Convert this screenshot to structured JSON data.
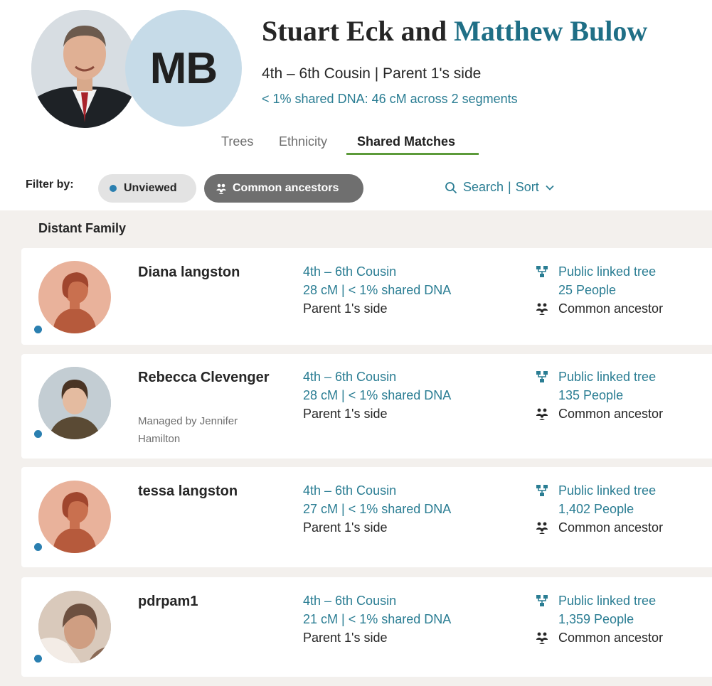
{
  "header": {
    "initials": "MB",
    "title_name_a": "Stuart Eck and ",
    "title_name_b": "Matthew Bulow",
    "relationship": "4th – 6th Cousin | Parent 1's side",
    "shared_dna": "< 1% shared DNA: 46 cM across 2 segments"
  },
  "tabs": [
    {
      "label": "Trees"
    },
    {
      "label": "Ethnicity"
    },
    {
      "label": "Shared Matches",
      "active": true
    }
  ],
  "filter": {
    "label": "Filter by:",
    "unviewed": "Unviewed",
    "common_ancestors": "Common ancestors",
    "search": "Search",
    "separator": "|",
    "sort": "Sort"
  },
  "section": {
    "title": "Distant Family"
  },
  "matches": [
    {
      "name": "Diana langston",
      "managed_by": "",
      "relationship": "4th – 6th Cousin",
      "dna": "28 cM | < 1% shared DNA",
      "side": "Parent 1's side",
      "tree": "Public linked tree",
      "people": "25 People",
      "ancestor": "Common ancestor",
      "avatar": "silhouette",
      "unviewed": true
    },
    {
      "name": "Rebecca Clevenger",
      "managed_by": "Managed by Jennifer Hamilton",
      "relationship": "4th – 6th Cousin",
      "dna": "28 cM | < 1% shared DNA",
      "side": "Parent 1's side",
      "tree": "Public linked tree",
      "people": "135 People",
      "ancestor": "Common ancestor",
      "avatar": "photo",
      "unviewed": true
    },
    {
      "name": "tessa langston",
      "managed_by": "",
      "relationship": "4th – 6th Cousin",
      "dna": "27 cM | < 1% shared DNA",
      "side": "Parent 1's side",
      "tree": "Public linked tree",
      "people": "1,402 People",
      "ancestor": "Common ancestor",
      "avatar": "silhouette",
      "unviewed": true
    },
    {
      "name": "pdrpam1",
      "managed_by": "",
      "relationship": "4th – 6th Cousin",
      "dna": "21 cM | < 1% shared DNA",
      "side": "Parent 1's side",
      "tree": "Public linked tree",
      "people": "1,359 People",
      "ancestor": "Common ancestor",
      "avatar": "photo",
      "unviewed": true
    }
  ],
  "colors": {
    "accent": "#2a7d93",
    "tab_underline": "#5c9a3a",
    "unviewed_dot": "#2a7fb0",
    "list_background": "#f3f0ed",
    "silhouette_bg": "#e9b29b"
  }
}
